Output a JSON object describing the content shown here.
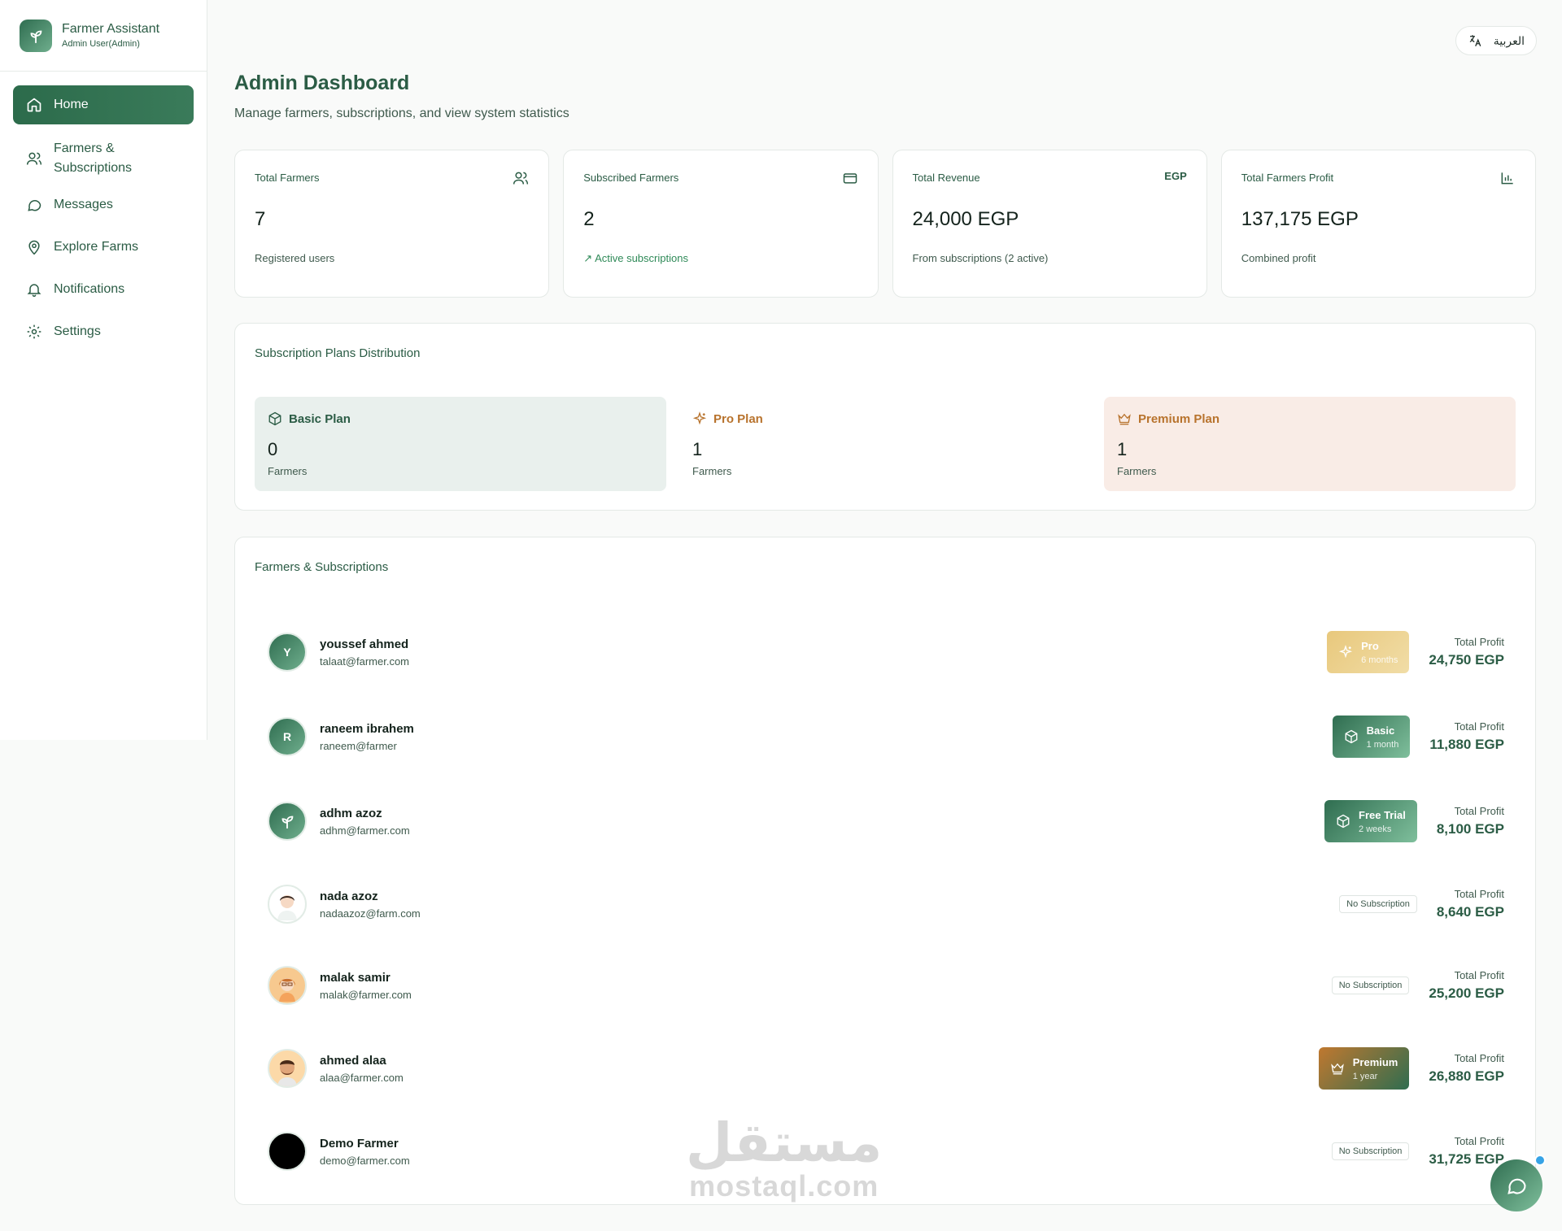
{
  "brand": {
    "title": "Farmer Assistant",
    "subtitle": "Admin User(Admin)"
  },
  "sidebar": {
    "items": [
      {
        "label": "Home",
        "icon": "home-icon",
        "active": true
      },
      {
        "label_line1": "Farmers &",
        "label_line2": "Subscriptions",
        "icon": "users-icon"
      },
      {
        "label": "Messages",
        "icon": "message-icon"
      },
      {
        "label": "Explore Farms",
        "icon": "map-pin-icon"
      },
      {
        "label": "Notifications",
        "icon": "bell-icon"
      },
      {
        "label": "Settings",
        "icon": "gear-icon"
      }
    ]
  },
  "language_toggle": {
    "label": "العربية",
    "icon": "translate-icon"
  },
  "header": {
    "title": "Admin Dashboard",
    "subtitle": "Manage farmers, subscriptions, and view system statistics"
  },
  "stats": [
    {
      "label": "Total Farmers",
      "value": "7",
      "note": "Registered users",
      "icon": "users-icon"
    },
    {
      "label": "Subscribed Farmers",
      "value": "2",
      "note": "Active subscriptions",
      "icon": "credit-card-icon"
    },
    {
      "label": "Total Revenue",
      "value": "24,000 EGP",
      "note": "From subscriptions (2 active)",
      "icon_text": "EGP"
    },
    {
      "label": "Total Farmers Profit",
      "value": "137,175 EGP",
      "note": "Combined profit",
      "icon": "bar-chart-icon"
    }
  ],
  "plans": {
    "title": "Subscription Plans Distribution",
    "items": [
      {
        "name": "Basic Plan",
        "count": "0",
        "unit": "Farmers",
        "color": "#2b5c45"
      },
      {
        "name": "Pro Plan",
        "count": "1",
        "unit": "Farmers",
        "color": "#b8732d"
      },
      {
        "name": "Premium Plan",
        "count": "1",
        "unit": "Farmers",
        "color": "#b8732d"
      }
    ]
  },
  "farmers": {
    "title": "Farmers & Subscriptions",
    "profit_label": "Total Profit",
    "rows": [
      {
        "initial": "Y",
        "name": "youssef ahmed",
        "email": "talaat@farmer.com",
        "sub_title": "Pro",
        "sub_duration": "6 months",
        "sub_type": "pro",
        "profit": "24,750 EGP"
      },
      {
        "initial": "R",
        "name": "raneem ibrahem",
        "email": "raneem@farmer",
        "sub_title": "Basic",
        "sub_duration": "1 month",
        "sub_type": "basic",
        "profit": "11,880 EGP"
      },
      {
        "name": "adhm azoz",
        "email": "adhm@farmer.com",
        "sub_title": "Free Trial",
        "sub_duration": "2 weeks",
        "sub_type": "basic",
        "profit": "8,100 EGP"
      },
      {
        "name": "nada azoz",
        "email": "nadaazoz@farm.com",
        "no_sub": "No Subscription",
        "profit": "8,640 EGP"
      },
      {
        "name": "malak samir",
        "email": "malak@farmer.com",
        "no_sub": "No Subscription",
        "profit": "25,200 EGP"
      },
      {
        "name": "ahmed alaa",
        "email": "alaa@farmer.com",
        "sub_title": "Premium",
        "sub_duration": "1 year",
        "sub_type": "premium",
        "profit": "26,880 EGP"
      },
      {
        "name": "Demo Farmer",
        "email": "demo@farmer.com",
        "no_sub": "No Subscription",
        "profit": "31,725 EGP"
      }
    ]
  },
  "watermark": {
    "arabic": "مستقل",
    "latin": "mostaql.com"
  },
  "colors": {
    "primary": "#2b5c45",
    "accent_orange": "#b8732d",
    "active_green": "#2f8a58"
  }
}
